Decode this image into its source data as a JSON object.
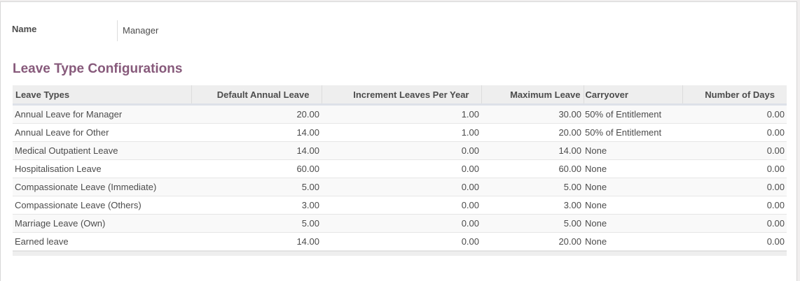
{
  "form": {
    "name_label": "Name",
    "name_value": "Manager"
  },
  "section": {
    "title": "Leave Type Configurations"
  },
  "table": {
    "columns": [
      "Leave Types",
      "Default Annual Leave",
      "Increment Leaves Per Year",
      "Maximum Leave",
      "Carryover",
      "Number of Days"
    ],
    "rows": [
      [
        "Annual Leave for Manager",
        "20.00",
        "1.00",
        "30.00",
        "50% of Entitlement",
        "0.00"
      ],
      [
        "Annual Leave for Other",
        "14.00",
        "1.00",
        "20.00",
        "50% of Entitlement",
        "0.00"
      ],
      [
        "Medical Outpatient Leave",
        "14.00",
        "0.00",
        "14.00",
        "None",
        "0.00"
      ],
      [
        "Hospitalisation Leave",
        "60.00",
        "0.00",
        "60.00",
        "None",
        "0.00"
      ],
      [
        "Compassionate Leave (Immediate)",
        "5.00",
        "0.00",
        "5.00",
        "None",
        "0.00"
      ],
      [
        "Compassionate Leave (Others)",
        "3.00",
        "0.00",
        "3.00",
        "None",
        "0.00"
      ],
      [
        "Marriage Leave (Own)",
        "5.00",
        "0.00",
        "5.00",
        "None",
        "0.00"
      ],
      [
        "Earned leave",
        "14.00",
        "0.00",
        "20.00",
        "None",
        "0.00"
      ]
    ]
  },
  "colors": {
    "title": "#875a7b",
    "header_bg": "#eeeeee",
    "text": "#4c4c4c"
  }
}
